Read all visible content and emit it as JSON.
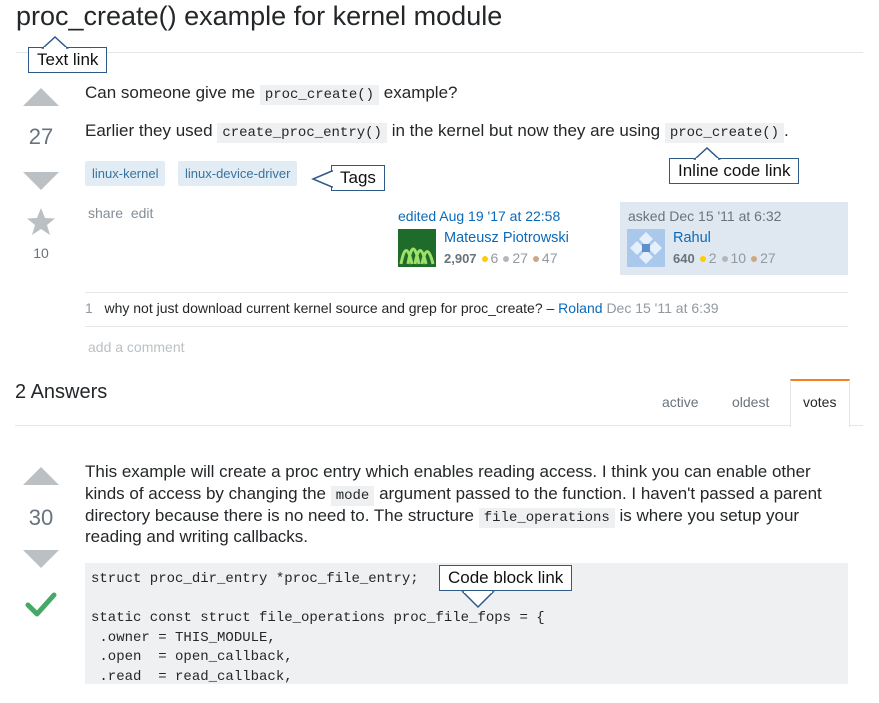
{
  "question": {
    "title": "proc_create() example for kernel module",
    "score": "27",
    "favorites": "10",
    "line1": {
      "before": "Can someone give me",
      "code": "proc_create()",
      "after": "example?"
    },
    "line2": {
      "before": "Earlier they used",
      "code1": "create_proc_entry()",
      "middle": "in the kernel but now they are using",
      "code2": "proc_create()",
      "after": "."
    },
    "tags": [
      "linux-kernel",
      "linux-device-driver"
    ],
    "menu": {
      "share": "share",
      "edit": "edit"
    },
    "edited": {
      "label": "edited Aug 19 '17 at 22:58",
      "user": "Mateusz Piotrowski",
      "rep": "2,907",
      "gold": "6",
      "silver": "27",
      "bronze": "47"
    },
    "asked": {
      "label": "asked Dec 15 '11 at 6:32",
      "user": "Rahul",
      "rep": "640",
      "gold": "2",
      "silver": "10",
      "bronze": "27"
    },
    "comment": {
      "votes": "1",
      "text": "why not just download current kernel source and grep for proc_create? –",
      "user": "Roland",
      "time": "Dec 15 '11 at 6:39"
    },
    "add_comment": "add a comment"
  },
  "answers_header": {
    "count_label": "2 Answers",
    "tabs": [
      "active",
      "oldest",
      "votes"
    ]
  },
  "answer": {
    "score": "30",
    "lines": [
      {
        "text": "This example will create a proc entry which enables reading access. I think you can enable other"
      },
      {
        "before": "kinds of access by changing the",
        "code": "mode",
        "after": "argument passed to the function. I haven't passed a parent"
      },
      {
        "before": "directory because there is no need to. The structure",
        "code": "file_operations",
        "after": "is where you setup your"
      },
      {
        "text": "reading and writing callbacks."
      }
    ],
    "code": [
      "struct proc_dir_entry *proc_file_entry;",
      "",
      "static const struct file_operations proc_file_fops = {",
      " .owner = THIS_MODULE,",
      " .open  = open_callback,",
      " .read  = read_callback,"
    ]
  },
  "callouts": {
    "text_link": "Text link",
    "inline_code_link": "Inline code link",
    "tags": "Tags",
    "code_block_link": "Code block link"
  },
  "colors": {
    "accent": "#f48024",
    "link": "#0c69b7",
    "tag_bg": "#e1ecf4",
    "tag_fg": "#39739d",
    "accepted": "#48a868",
    "signature_bg": "#dfe8f1"
  }
}
